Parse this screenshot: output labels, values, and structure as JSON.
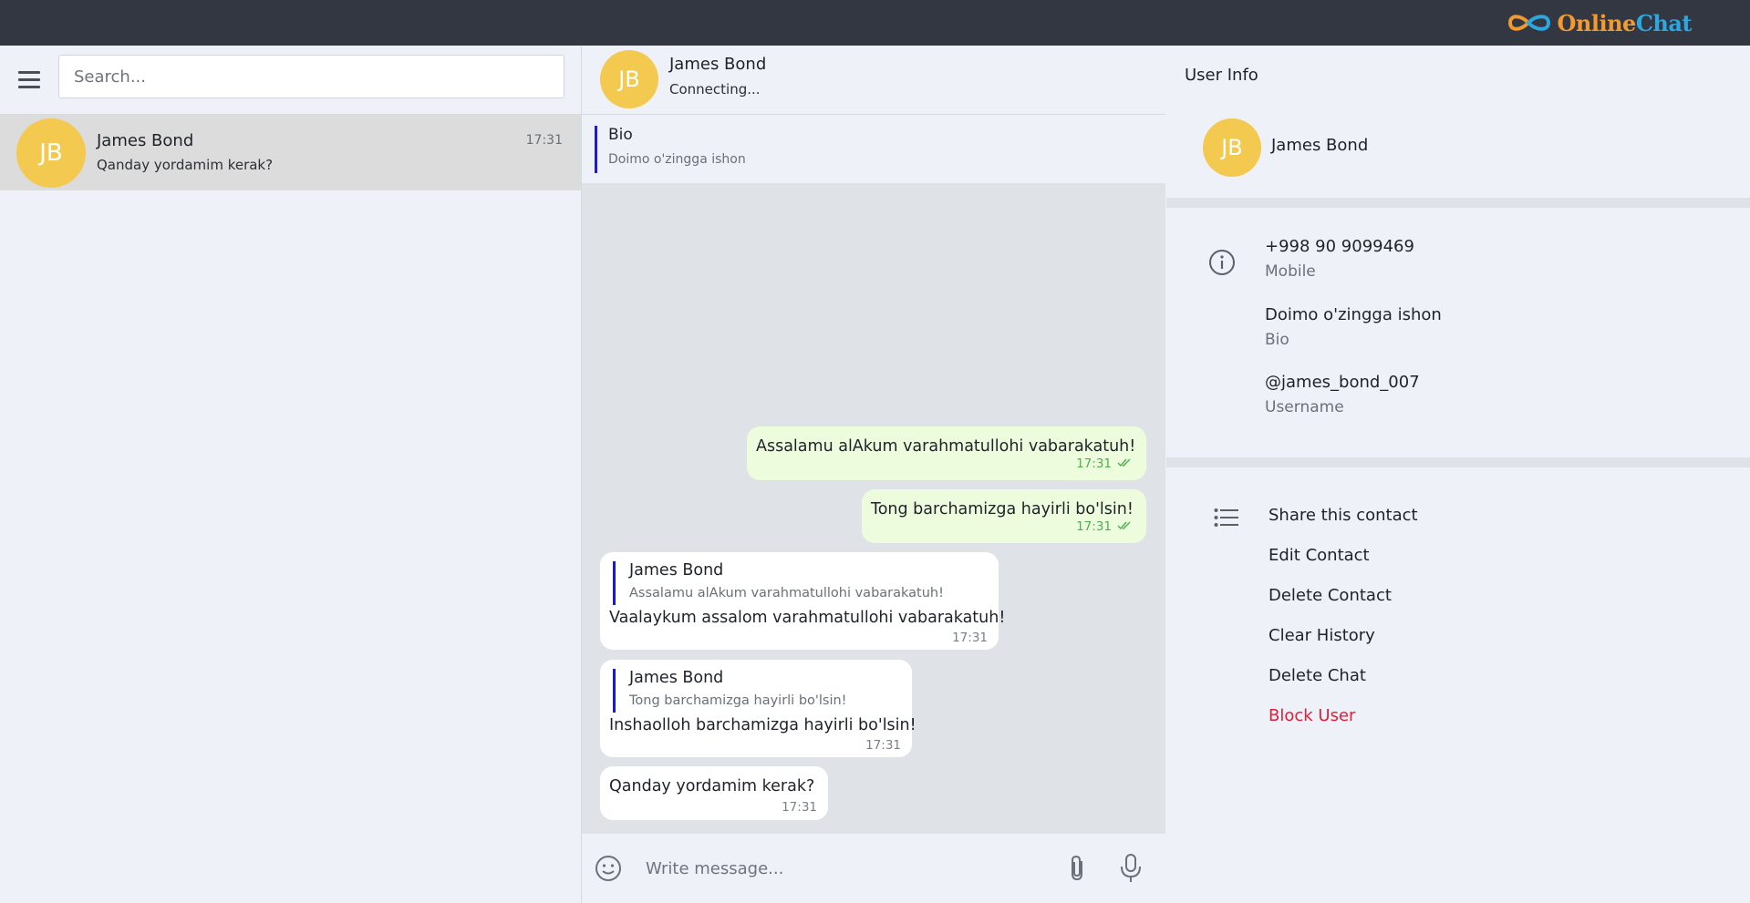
{
  "brand": {
    "name_part1": "Online",
    "name_part2": "Chat",
    "logo_icon": "infinity-logo-icon"
  },
  "sidebar": {
    "menu_icon": "hamburger-menu-icon",
    "search_placeholder": "Search...",
    "chats": [
      {
        "initials": "JB",
        "name": "James Bond",
        "preview": "Qanday yordamim kerak?",
        "time": "17:31"
      }
    ]
  },
  "chat": {
    "initials": "JB",
    "name": "James Bond",
    "status": "Connecting...",
    "pinned": {
      "title": "Bio",
      "text": "Doimo o'zingga ishon"
    },
    "messages": [
      {
        "direction": "out",
        "text": "Assalamu alAkum varahmatullohi vabarakatuh!",
        "time": "17:31"
      },
      {
        "direction": "out",
        "text": "Tong barchamizga hayirli bo'lsin!",
        "time": "17:31"
      },
      {
        "direction": "in",
        "reply_name": "James Bond",
        "reply_text": "Assalamu alAkum varahmatullohi vabarakatuh!",
        "text": "Vaalaykum assalom varahmatullohi vabarakatuh!",
        "time": "17:31"
      },
      {
        "direction": "in",
        "reply_name": "James Bond",
        "reply_text": "Tong barchamizga hayirli bo'lsin!",
        "text": "Inshaolloh barchamizga hayirli bo'lsin!",
        "time": "17:31"
      },
      {
        "direction": "in",
        "text": "Qanday yordamim kerak?",
        "time": "17:31"
      }
    ],
    "compose_placeholder": "Write message...",
    "icons": {
      "emoji": "emoji-icon",
      "attach": "paperclip-icon",
      "mic": "microphone-icon",
      "read": "double-check-icon"
    }
  },
  "user_info": {
    "title": "User Info",
    "initials": "JB",
    "name": "James Bond",
    "details": [
      {
        "value": "+998 90 9099469",
        "label": "Mobile"
      },
      {
        "value": "Doimo o'zingga ishon",
        "label": "Bio"
      },
      {
        "value": "@james_bond_007",
        "label": "Username"
      }
    ],
    "actions": [
      "Share this contact",
      "Edit Contact",
      "Delete Contact",
      "Clear History",
      "Delete Chat"
    ],
    "block_action": "Block User",
    "colors": {
      "danger": "#dc1f3a",
      "avatar": "#f3c94f",
      "accent_quote": "#1c1cc8"
    }
  }
}
